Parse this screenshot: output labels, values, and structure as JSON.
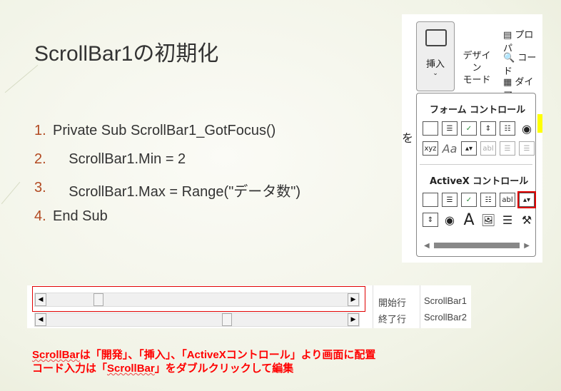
{
  "title": "ScrollBar1の初期化",
  "code": [
    {
      "num": "1.",
      "text": "Private Sub ScrollBar1_GotFocus()"
    },
    {
      "num": "2.",
      "text": "    ScrollBar1.Min = 2"
    },
    {
      "num": "3.",
      "text": "    ScrollBar1.Max = Range(\"データ数\")"
    },
    {
      "num": "4.",
      "text": "End Sub"
    }
  ],
  "ribbon": {
    "insert": "挿入",
    "design1": "デザイン",
    "design2": "モード",
    "props": "プロパ",
    "code": "コード",
    "dialog": "ダイア",
    "side_char": "を",
    "form_controls": "フォーム コントロール",
    "activex_controls": "ActiveX コントロール"
  },
  "sheet": {
    "r1label": "開始行",
    "r1value": "ScrollBar1",
    "r2label": "終了行",
    "r2value": "ScrollBar2",
    "scrollbar1_position": 0.16,
    "scrollbar2_position": 0.6
  },
  "note": {
    "line1_a": "ScrollBar",
    "line1_b": "は「開発」、「挿入」、「ActiveXコントロール」より画面に配置",
    "line2_a": "コード入力は「",
    "line2_b": "ScrollBar",
    "line2_c": "」をダブルクリックして編集"
  }
}
